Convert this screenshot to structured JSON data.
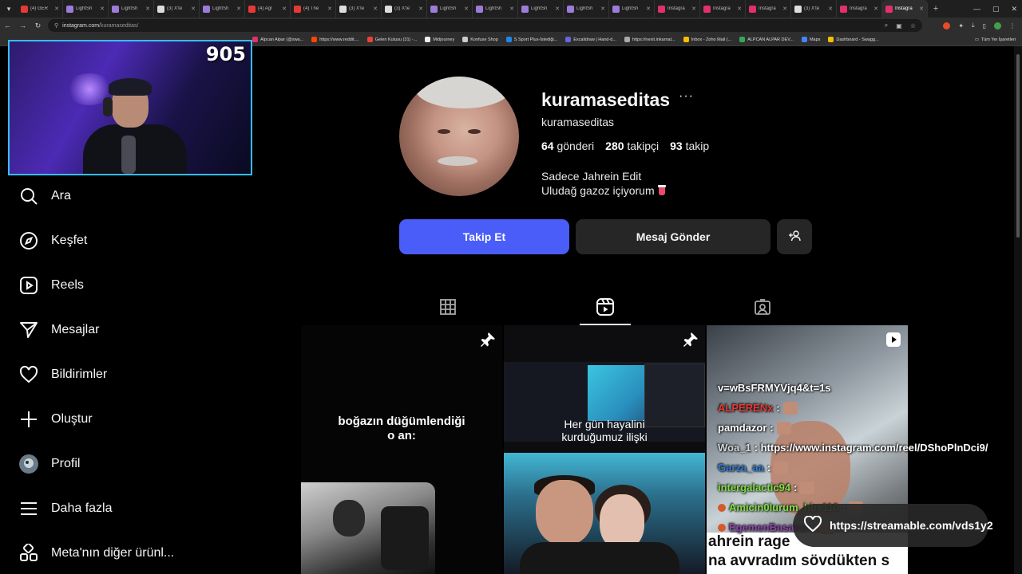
{
  "browser": {
    "tabs": [
      {
        "title": "(4) GER",
        "color": "#e53935"
      },
      {
        "title": "LightSh",
        "color": "#9c7bd9"
      },
      {
        "title": "LightSh",
        "color": "#9c7bd9"
      },
      {
        "title": "(3) X'te",
        "color": "#dddddd"
      },
      {
        "title": "LightSh",
        "color": "#9c7bd9"
      },
      {
        "title": "(4) Agr",
        "color": "#e53935"
      },
      {
        "title": "(4) The",
        "color": "#e53935"
      },
      {
        "title": "(3) X'te",
        "color": "#dddddd"
      },
      {
        "title": "(3) X'te",
        "color": "#dddddd"
      },
      {
        "title": "LightSh",
        "color": "#9c7bd9"
      },
      {
        "title": "LightSh",
        "color": "#9c7bd9"
      },
      {
        "title": "LightSh",
        "color": "#9c7bd9"
      },
      {
        "title": "LightSh",
        "color": "#9c7bd9"
      },
      {
        "title": "LightSh",
        "color": "#9c7bd9"
      },
      {
        "title": "Instagra",
        "color": "#e1306c"
      },
      {
        "title": "Instagra",
        "color": "#e1306c"
      },
      {
        "title": "Instagra",
        "color": "#e1306c"
      },
      {
        "title": "(3) X'te",
        "color": "#dddddd"
      },
      {
        "title": "Instagra",
        "color": "#e1306c"
      },
      {
        "title": "Instagra",
        "color": "#e1306c",
        "active": true
      }
    ],
    "url_host": "instagram.com",
    "url_path": "/kuramaseditas/",
    "bookmarks": [
      {
        "label": "Alpcan Alpar (@swa...",
        "color": "#e1306c"
      },
      {
        "label": "https://www.reddit....",
        "color": "#ff4500"
      },
      {
        "label": "Gelen Kutusu (31) -...",
        "color": "#ea4335"
      },
      {
        "label": "Midjourney",
        "color": "#eeeeee"
      },
      {
        "label": "Konfuse Shop",
        "color": "#cccccc"
      },
      {
        "label": "S Sport Plus-İstediği...",
        "color": "#1e88e5"
      },
      {
        "label": "Excalidraw | Hand-d...",
        "color": "#6965db"
      },
      {
        "label": "https://nexit.inkarnat...",
        "color": "#aaaaaa"
      },
      {
        "label": "Inbox - Zoho Mail (...",
        "color": "#fbbc04"
      },
      {
        "label": "ALPCAN ALPAR DEV...",
        "color": "#34a853"
      },
      {
        "label": "Maps",
        "color": "#4285f4"
      },
      {
        "label": "Dashboard - Swagg...",
        "color": "#fbbc04"
      }
    ],
    "bookmarks_all": "Tüm Yer İşaretleri"
  },
  "webcam": {
    "counter": "905"
  },
  "sidebar": {
    "items": [
      {
        "label": "Ara",
        "icon": "search-icon"
      },
      {
        "label": "Keşfet",
        "icon": "compass-icon"
      },
      {
        "label": "Reels",
        "icon": "reels-icon"
      },
      {
        "label": "Mesajlar",
        "icon": "send-icon"
      },
      {
        "label": "Bildirimler",
        "icon": "heart-icon"
      },
      {
        "label": "Oluştur",
        "icon": "plus-icon"
      },
      {
        "label": "Profil",
        "icon": "avatar-icon"
      },
      {
        "label": "Daha fazla",
        "icon": "menu-icon"
      },
      {
        "label": "Meta'nın diğer ürünl...",
        "icon": "apps-icon"
      }
    ]
  },
  "profile": {
    "username": "kuramaseditas",
    "full_name": "kuramaseditas",
    "posts_count": "64",
    "posts_label": "gönderi",
    "followers_count": "280",
    "followers_label": "takipçi",
    "following_count": "93",
    "following_label": "takip",
    "bio_line1": "Sadece Jahrein Edit",
    "bio_line2": "Uludağ gazoz içiyorum",
    "follow_label": "Takip Et",
    "message_label": "Mesaj Gönder",
    "accent": "#4a5df9"
  },
  "posts": {
    "p1": {
      "caption_line1": "boğazın düğümlendiği",
      "caption_line2": "o an:"
    },
    "p2": {
      "caption_line1": "Her gün hayalini",
      "caption_line2": "kurduğumuz ilişki"
    },
    "p3": {
      "chat": [
        {
          "user": "",
          "msg": "v=wBsFRMYVjq4&t=1s",
          "color": "#ffffff"
        },
        {
          "user": "ALPERENx",
          "msg": " :",
          "color": "#e53935"
        },
        {
          "user": "pamdazor",
          "msg": " :",
          "color": "#ffffff"
        },
        {
          "user": "Woa_1",
          "msg": " : https://www.instagram.com/reel/DShoPlnDci9/",
          "color": "#d7d7d7"
        },
        {
          "user": "Garza_aa",
          "msg": " :",
          "color": "#2e7fd6"
        },
        {
          "user": "intergalactic94",
          "msg": " :",
          "color": "#7ee040"
        },
        {
          "user": "Amicin0lurum_hbs110",
          "msg": " :",
          "color": "#7ee040"
        },
        {
          "user": "EgemenBasaran",
          "msg": " :",
          "color": "#8e44ad"
        }
      ],
      "bottom_line1": "ahrein rage",
      "bottom_line2": "na avvradım sövdükten s"
    },
    "link_pill": "https://streamable.com/vds1y2"
  }
}
